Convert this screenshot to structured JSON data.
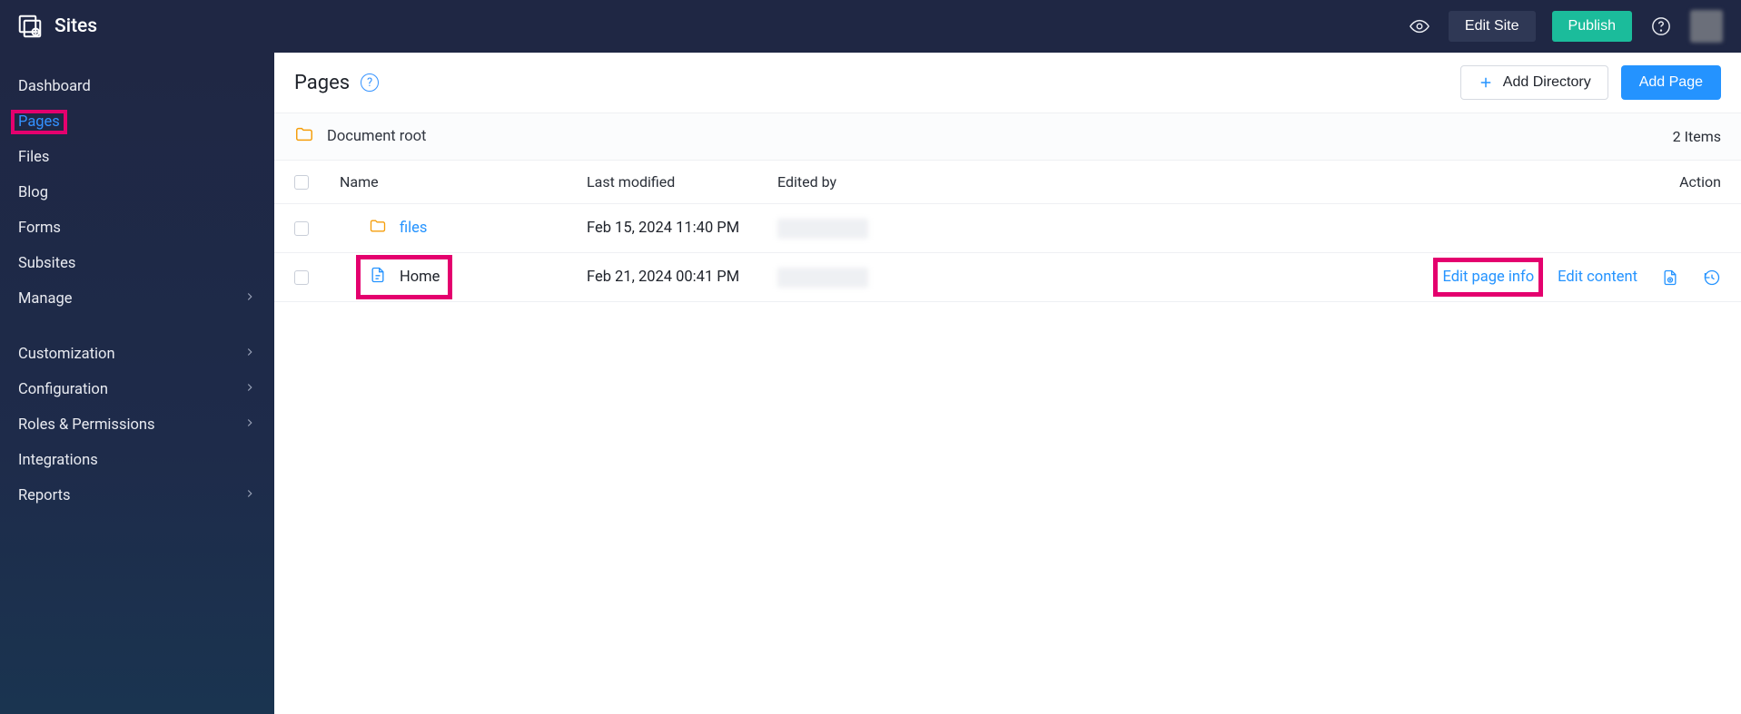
{
  "header": {
    "appName": "Sites",
    "editSite": "Edit Site",
    "publish": "Publish"
  },
  "sidebar": {
    "items": [
      {
        "label": "Dashboard",
        "submenu": false,
        "active": false
      },
      {
        "label": "Pages",
        "submenu": false,
        "active": true,
        "highlight": true
      },
      {
        "label": "Files",
        "submenu": false,
        "active": false
      },
      {
        "label": "Blog",
        "submenu": false,
        "active": false
      },
      {
        "label": "Forms",
        "submenu": false,
        "active": false
      },
      {
        "label": "Subsites",
        "submenu": false,
        "active": false
      },
      {
        "label": "Manage",
        "submenu": true,
        "active": false
      }
    ],
    "items2": [
      {
        "label": "Customization",
        "submenu": true
      },
      {
        "label": "Configuration",
        "submenu": true
      },
      {
        "label": "Roles & Permissions",
        "submenu": true
      },
      {
        "label": "Integrations",
        "submenu": false
      },
      {
        "label": "Reports",
        "submenu": true
      }
    ]
  },
  "page": {
    "title": "Pages",
    "addDirectory": "Add Directory",
    "addPage": "Add Page"
  },
  "crumb": {
    "root": "Document root",
    "count": "2 Items"
  },
  "columns": {
    "name": "Name",
    "modified": "Last modified",
    "editedBy": "Edited by",
    "action": "Action"
  },
  "rows": [
    {
      "type": "folder",
      "name": "files",
      "modified": "Feb 15, 2024 11:40 PM",
      "link": true,
      "actions": false
    },
    {
      "type": "page",
      "name": "Home",
      "modified": "Feb 21, 2024 00:41 PM",
      "link": false,
      "actions": true,
      "highlight": true
    }
  ],
  "actions": {
    "editPageInfo": "Edit page info",
    "editContent": "Edit content"
  }
}
